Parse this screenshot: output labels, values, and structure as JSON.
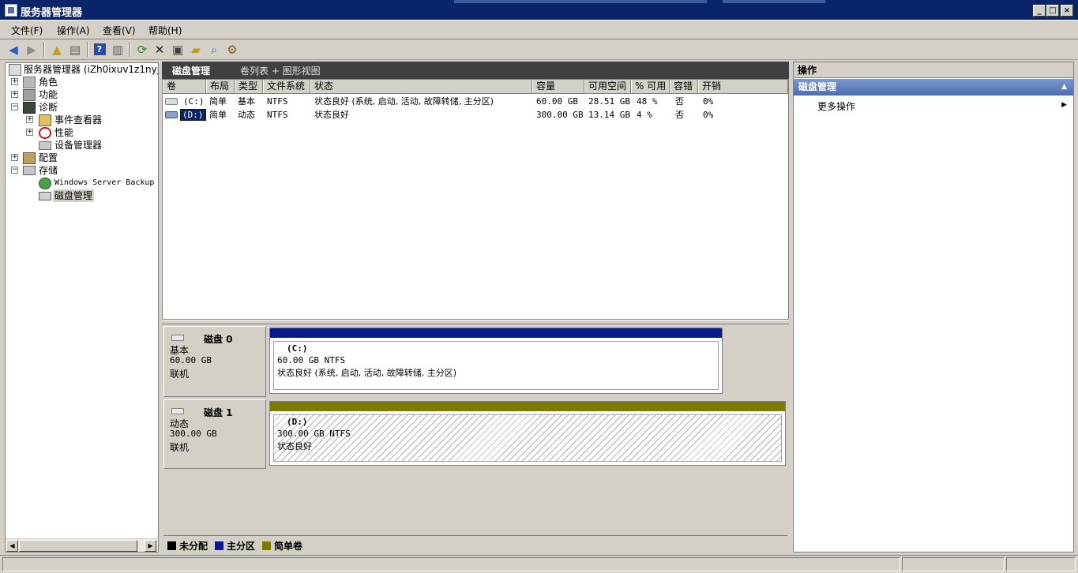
{
  "window": {
    "title": "服务器管理器"
  },
  "menu": [
    "文件(F)",
    "操作(A)",
    "查看(V)",
    "帮助(H)"
  ],
  "toolbar": [
    "back-icon",
    "forward-icon",
    "up-folder-icon",
    "show-hide-tree-icon",
    "help-icon",
    "show-hide-action-icon",
    "refresh-icon",
    "delete-icon",
    "properties-icon",
    "open-folder-icon",
    "search-icon",
    "settings-icon"
  ],
  "tree": {
    "root": "服务器管理器 (iZh0ixuv1z1nyj",
    "items": {
      "roles": "角色",
      "features": "功能",
      "diagnostics": "诊断",
      "event_viewer": "事件查看器",
      "performance": "性能",
      "device_manager": "设备管理器",
      "config": "配置",
      "storage": "存储",
      "wsb": "Windows Server Backup",
      "disk_mgmt": "磁盘管理"
    }
  },
  "center": {
    "title": "磁盘管理",
    "view": "卷列表 + 图形视图"
  },
  "columns": [
    "卷",
    "布局",
    "类型",
    "文件系统",
    "状态",
    "容量",
    "可用空间",
    "% 可用",
    "容错",
    "开销"
  ],
  "volumes": [
    {
      "vol": "(C:)",
      "layout": "简单",
      "type": "基本",
      "fs": "NTFS",
      "status": "状态良好 (系统, 启动, 活动, 故障转储, 主分区)",
      "capacity": "60.00 GB",
      "free": "28.51 GB",
      "pct": "48 %",
      "ft": "否",
      "overhead": "0%"
    },
    {
      "vol": "(D:)",
      "layout": "简单",
      "type": "动态",
      "fs": "NTFS",
      "status": "状态良好",
      "capacity": "300.00 GB",
      "free": "13.14 GB",
      "pct": "4 %",
      "ft": "否",
      "overhead": "0%"
    }
  ],
  "disks": [
    {
      "name": "磁盘 0",
      "kind": "基本",
      "size": "60.00 GB",
      "state": "联机",
      "part_name": "(C:)",
      "part_size": "60.00 GB NTFS",
      "part_status": "状态良好 (系统, 启动, 活动, 故障转储, 主分区)"
    },
    {
      "name": "磁盘 1",
      "kind": "动态",
      "size": "300.00 GB",
      "state": "联机",
      "part_name": "(D:)",
      "part_size": "300.00 GB NTFS",
      "part_status": "状态良好"
    }
  ],
  "legend": [
    {
      "label": "未分配",
      "color": "#000000"
    },
    {
      "label": "主分区",
      "color": "#0a1a8c"
    },
    {
      "label": "简单卷",
      "color": "#7d7a00"
    }
  ],
  "actions": {
    "header": "操作",
    "section": "磁盘管理",
    "more": "更多操作"
  },
  "colors": {
    "titlebar": "#0a246a",
    "primary_partition": "#0a1a8c",
    "simple_volume": "#7d7a00"
  }
}
